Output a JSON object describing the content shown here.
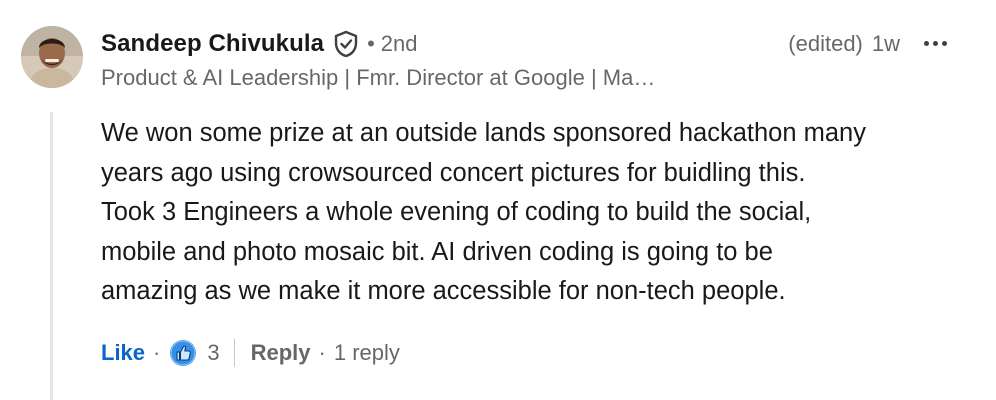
{
  "comment": {
    "author": {
      "name": "Sandeep Chivukula",
      "connection_degree": "2nd",
      "degree_separator": "•",
      "headline": "Product & AI Leadership | Fmr. Director at Google | Ma…",
      "avatar_icon": "profile-photo",
      "verified_icon": "verified-shield-icon"
    },
    "edited_label": "(edited)",
    "timestamp": "1w",
    "body_lines": [
      "We won some prize at an outside lands sponsored hackathon many",
      "years ago using crowsourced concert pictures for buidling this.",
      "Took 3 Engineers a whole evening of coding to build the social,",
      "mobile and photo mosaic bit. AI driven coding is going to be",
      "amazing as we make it more accessible for non-tech people."
    ],
    "actions": {
      "like_label": "Like",
      "separator": "·",
      "reaction_icon": "like-thumbs-up-icon",
      "reaction_count": "3",
      "reply_label": "Reply",
      "reply_count_label": "1 reply"
    }
  },
  "colors": {
    "link_blue": "#0a66c2",
    "text_primary": "rgba(0,0,0,0.9)",
    "text_secondary": "rgba(0,0,0,0.6)",
    "thread_line": "#e8e6e1"
  }
}
